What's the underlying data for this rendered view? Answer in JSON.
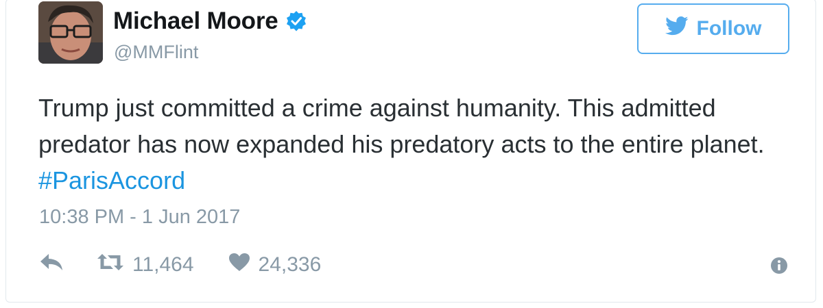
{
  "author": {
    "name": "Michael Moore",
    "handle": "@MMFlint",
    "verified": true
  },
  "follow_button": {
    "label": "Follow",
    "icon": "twitter-bird-icon"
  },
  "tweet": {
    "text": "Trump just committed a crime against humanity. This admitted predator has now expanded his predatory acts to the entire planet. ",
    "hashtag": "#ParisAccord",
    "timestamp": "10:38 PM - 1 Jun 2017"
  },
  "actions": {
    "reply_icon": "reply-icon",
    "retweet_icon": "retweet-icon",
    "retweet_count": "11,464",
    "like_icon": "heart-icon",
    "like_count": "24,336",
    "info_icon": "info-icon"
  },
  "colors": {
    "accent": "#55acee",
    "link": "#1b95e0",
    "muted": "#8899a6",
    "text": "#292f33"
  }
}
